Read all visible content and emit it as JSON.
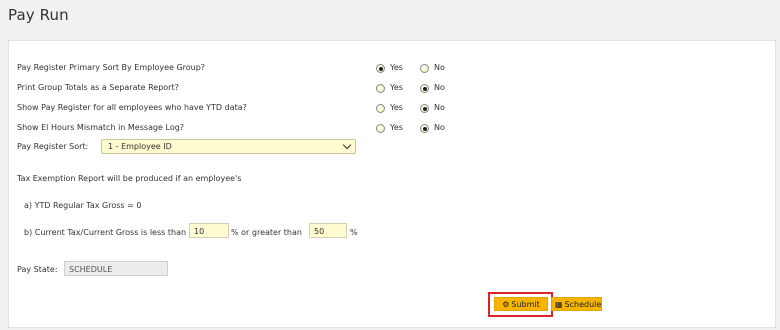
{
  "page": {
    "title": "Pay Run"
  },
  "questions": [
    {
      "label": "Pay Register Primary Sort By Employee Group?",
      "selected": "Yes"
    },
    {
      "label": "Print Group Totals as a Separate Report?",
      "selected": "No"
    },
    {
      "label": "Show Pay Register for all employees who have YTD data?",
      "selected": "No"
    },
    {
      "label": "Show El Hours Mismatch in Message Log?",
      "selected": "No"
    }
  ],
  "options": {
    "yes": "Yes",
    "no": "No"
  },
  "sort": {
    "label": "Pay Register Sort:",
    "value": "1 - Employee ID"
  },
  "tax": {
    "intro": "Tax Exemption Report will be produced if an employee's",
    "line_a": "a) YTD Regular Tax Gross = 0",
    "line_b_prefix": "b) Current Tax/Current Gross is less than",
    "less_than_value": "10",
    "middle": "% or greater than",
    "greater_than_value": "50",
    "suffix": "%"
  },
  "pay_state": {
    "label": "Pay State:",
    "value": "SCHEDULE"
  },
  "actions": {
    "submit_label": "Submit",
    "schedule_label": "Schedule"
  },
  "colors": {
    "button": "#f5b400",
    "field": "#fdfbcf",
    "highlight": "#d9252a"
  }
}
